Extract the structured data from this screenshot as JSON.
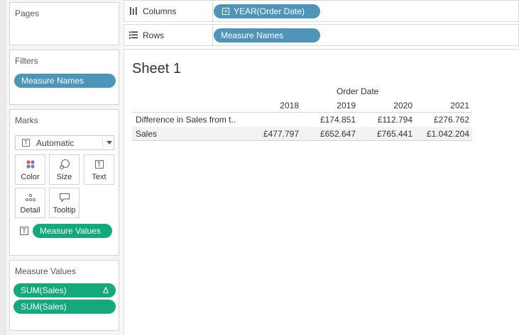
{
  "pages": {
    "title": "Pages"
  },
  "columns_shelf": {
    "label": "Columns",
    "pill": "YEAR(Order Date)"
  },
  "rows_shelf": {
    "label": "Rows",
    "pill": "Measure Names"
  },
  "filters": {
    "title": "Filters",
    "pills": [
      "Measure Names"
    ]
  },
  "marks": {
    "title": "Marks",
    "type": "Automatic",
    "buttons": [
      {
        "label": "Color",
        "icon": "color-icon"
      },
      {
        "label": "Size",
        "icon": "size-icon"
      },
      {
        "label": "Text",
        "icon": "text-icon"
      },
      {
        "label": "Detail",
        "icon": "detail-icon"
      },
      {
        "label": "Tooltip",
        "icon": "tooltip-icon"
      }
    ],
    "text_pill": "Measure Values"
  },
  "measure_values": {
    "title": "Measure Values",
    "pills": [
      {
        "label": "SUM(Sales)",
        "badge": "Δ"
      },
      {
        "label": "SUM(Sales)",
        "badge": ""
      }
    ]
  },
  "sheet": {
    "title": "Sheet 1",
    "column_header": "Order Date",
    "years": [
      "2018",
      "2019",
      "2020",
      "2021"
    ],
    "rows": [
      {
        "label": "Difference in Sales from t..",
        "values": [
          "",
          "£174.851",
          "£112.794",
          "£276.762"
        ]
      },
      {
        "label": "Sales",
        "values": [
          "£477.797",
          "£652.647",
          "£765.441",
          "£1.042.204"
        ]
      }
    ]
  },
  "colors": {
    "pill_blue": "#4e95b9",
    "pill_green": "#13a97d"
  }
}
